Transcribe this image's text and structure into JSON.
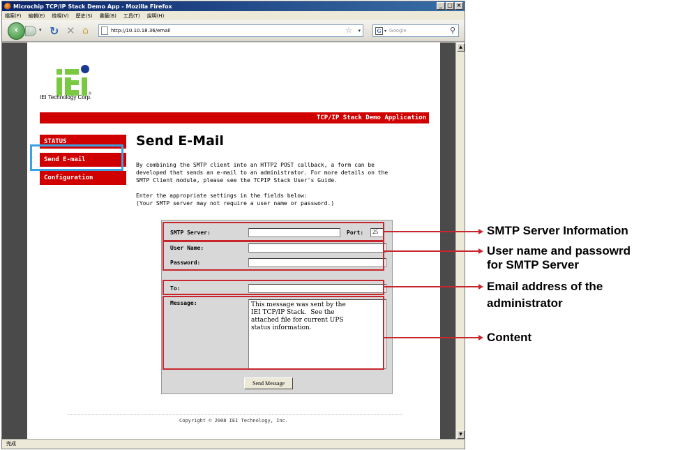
{
  "browser": {
    "window_title": "Microchip TCP/IP Stack Demo App - Mozilla Firefox",
    "menus": [
      "檔案(F)",
      "編輯(E)",
      "檢視(V)",
      "歷史(S)",
      "書籤(B)",
      "工具(T)",
      "說明(H)"
    ],
    "url": "http://10.10.18.36/email",
    "search_placeholder": "Google",
    "status_text": "完成"
  },
  "page": {
    "company_name": "IEI Technology Corp.",
    "banner": "TCP/IP Stack Demo Application",
    "nav": [
      {
        "label": "STATUS"
      },
      {
        "label": "Send E-mail"
      },
      {
        "label": "Configuration"
      }
    ],
    "heading": "Send E-Mail",
    "intro": "By combining the SMTP client into an HTTP2 POST callback, a form can be\ndeveloped that sends an e-mail to an administrator. For more details on the\nSMTP Client module, please see the TCPIP Stack User's Guide.",
    "instructions": "Enter the appropriate settings in the fields below:\n(Your SMTP server may not require a user name or password.)",
    "form": {
      "smtp_server_label": "SMTP Server:",
      "smtp_server_value": "",
      "port_label": "Port:",
      "port_value": "25",
      "username_label": "User Name:",
      "username_value": "",
      "password_label": "Password:",
      "password_value": "",
      "to_label": "To:",
      "to_value": "",
      "message_label": "Message:",
      "message_value": "This message was sent by the\nIEI TCP/IP Stack.  See the\nattached file for current UPS\nstatus information.",
      "send_button": "Send Message"
    },
    "copyright": "Copyright © 2008 IEI Technology, Inc."
  },
  "annotations": {
    "smtp_info": "SMTP Server Information",
    "credentials_line1": "User name and passowrd",
    "credentials_line2": "for SMTP Server",
    "email_line1": "Email address of the",
    "email_line2": "administrator",
    "content": "Content"
  },
  "colors": {
    "brand_red": "#d10000",
    "highlight_blue": "#3aa2e0",
    "callout_red": "#c8252c",
    "logo_green": "#7ac943",
    "logo_blue": "#1a3a8f"
  }
}
